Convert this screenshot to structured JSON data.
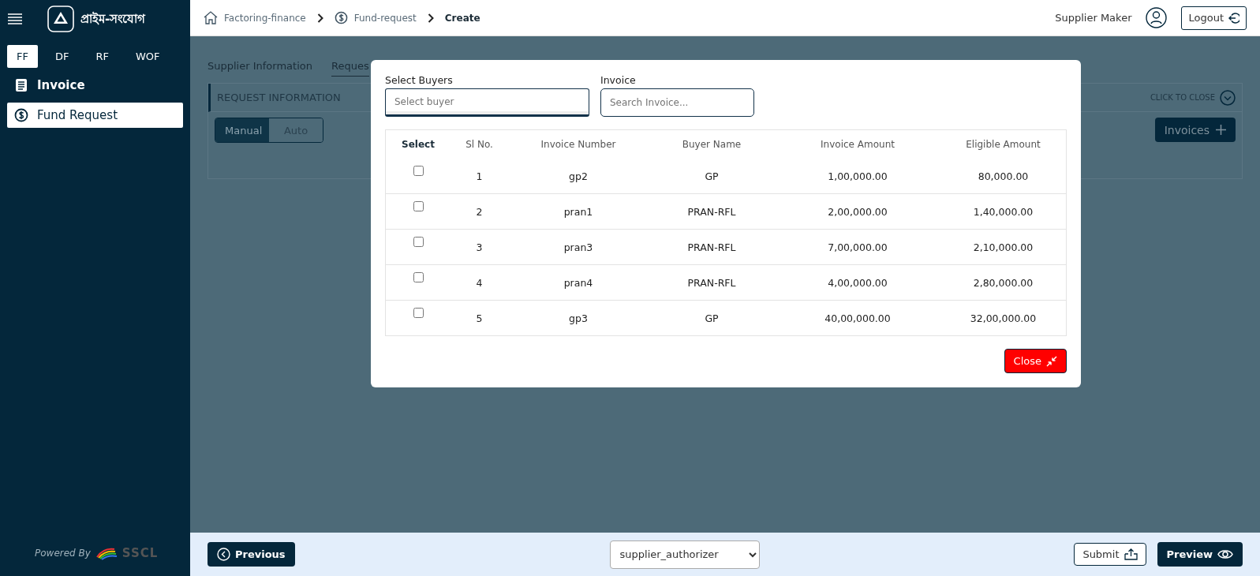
{
  "sidebar": {
    "logo_text": "প্রাইম-সংযোগ",
    "product_tabs": [
      {
        "label": "FF",
        "selected": true
      },
      {
        "label": "DF",
        "selected": false
      },
      {
        "label": "RF",
        "selected": false
      },
      {
        "label": "WOF",
        "selected": false
      }
    ],
    "menu": [
      {
        "label": "Invoice",
        "kind": "list",
        "selected": false
      },
      {
        "label": "Fund Request",
        "kind": "money",
        "selected": true
      }
    ],
    "powered_by": "Powered By",
    "brand": "SSCL"
  },
  "breadcrumb": [
    {
      "label": "Factoring-finance",
      "kind": "home"
    },
    {
      "label": "Fund-request",
      "kind": "money"
    },
    {
      "label": "Create",
      "kind": "current"
    }
  ],
  "user": {
    "name": "Supplier Maker",
    "logout": "Logout"
  },
  "page": {
    "tabs": [
      {
        "label": "Supplier Information",
        "selected": false
      },
      {
        "label": "Reques",
        "selected": true
      }
    ],
    "section_title": "REQUEST INFORMATION",
    "collapse_label": "CLICK TO CLOSE",
    "modes": [
      {
        "label": "Manual",
        "selected": true
      },
      {
        "label": "Auto",
        "selected": false
      }
    ],
    "invoices_button": "Invoices"
  },
  "modal": {
    "buyer_field": {
      "label": "Select Buyers",
      "placeholder": "Select buyer"
    },
    "invoice_field": {
      "label": "Invoice",
      "placeholder": "Search Invoice..."
    },
    "columns": [
      "Select",
      "Sl No.",
      "Invoice Number",
      "Buyer Name",
      "Invoice Amount",
      "Eligible Amount"
    ],
    "rows": [
      {
        "checked": false,
        "sl": "1",
        "invoice": "gp2",
        "buyer": "GP",
        "amount": "1,00,000.00",
        "eligible": "80,000.00"
      },
      {
        "checked": false,
        "sl": "2",
        "invoice": "pran1",
        "buyer": "PRAN-RFL",
        "amount": "2,00,000.00",
        "eligible": "1,40,000.00"
      },
      {
        "checked": false,
        "sl": "3",
        "invoice": "pran3",
        "buyer": "PRAN-RFL",
        "amount": "7,00,000.00",
        "eligible": "2,10,000.00"
      },
      {
        "checked": false,
        "sl": "4",
        "invoice": "pran4",
        "buyer": "PRAN-RFL",
        "amount": "4,00,000.00",
        "eligible": "2,80,000.00"
      },
      {
        "checked": false,
        "sl": "5",
        "invoice": "gp3",
        "buyer": "GP",
        "amount": "40,00,000.00",
        "eligible": "32,00,000.00"
      }
    ],
    "close_button": "Close"
  },
  "footer": {
    "previous": "Previous",
    "role_select": "supplier_authorizer",
    "submit": "Submit",
    "preview": "Preview"
  }
}
